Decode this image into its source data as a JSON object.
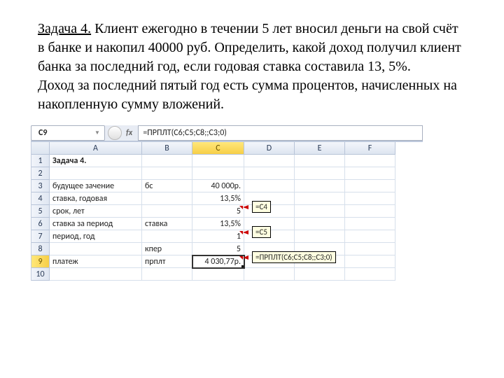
{
  "problem": {
    "title": "Задача 4.",
    "body_part1": "Клиент ежегодно в течении 5 лет вносил деньги на свой счёт в банке и накопил 40000 руб. Определить, какой доход получил клиент банка за последний год, если годовая ставка составила 13, 5%.",
    "body_part2": "Доход за последний пятый год есть сумма процентов, начисленных на накопленную сумму вложений."
  },
  "excel": {
    "active_cell": "C9",
    "formula": "=ПРПЛТ(C6;C5;C8;;C3;0)",
    "columns": [
      "A",
      "B",
      "C",
      "D",
      "E",
      "F"
    ],
    "rows": {
      "1": {
        "A": "Задача 4."
      },
      "2": {},
      "3": {
        "A": "будущее зачение",
        "B": "бс",
        "C": "40 000р."
      },
      "4": {
        "A": "ставка, годовая",
        "C": "13,5%"
      },
      "5": {
        "A": "срок, лет",
        "C": "5",
        "tip": "=C4"
      },
      "6": {
        "A": "ставка за период",
        "B": "ставка",
        "C": "13,5%"
      },
      "7": {
        "A": "период, год",
        "C": "1",
        "tip": "=C5"
      },
      "8": {
        "B": "кпер",
        "C": "5"
      },
      "9": {
        "A": "платеж",
        "B": "прплт",
        "C": "4 030,77р.",
        "tip": "=ПРПЛТ(C6;C5;C8;;C3;0)"
      },
      "10": {}
    }
  }
}
